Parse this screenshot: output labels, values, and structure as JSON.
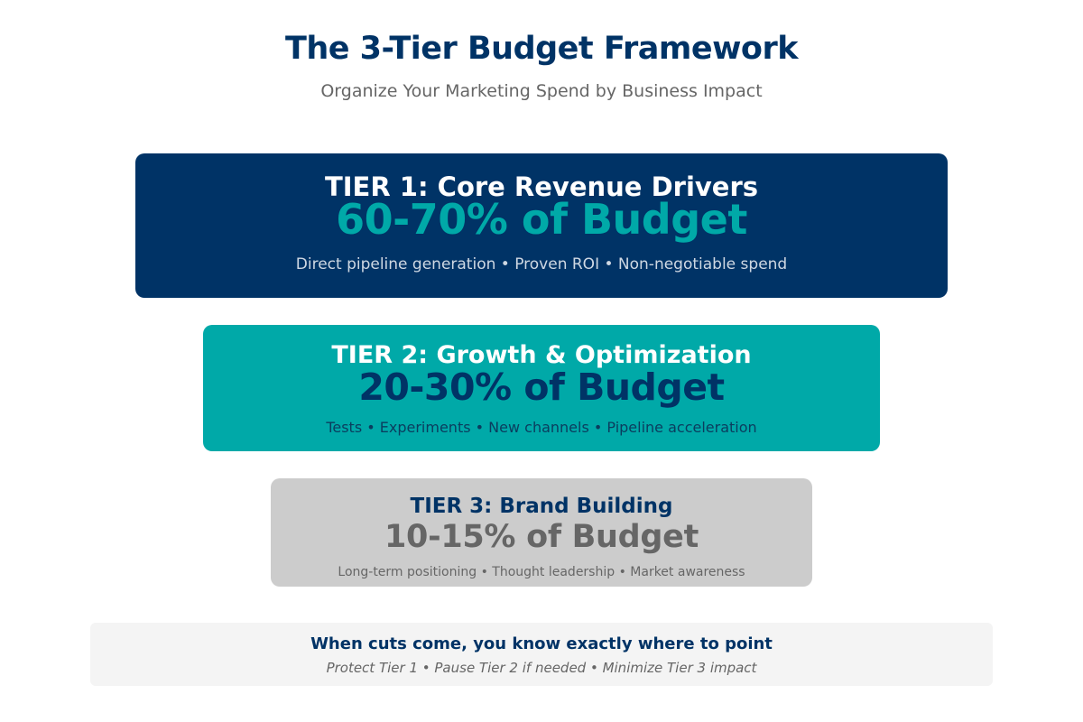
{
  "header": {
    "title": "The 3-Tier Budget Framework",
    "subtitle": "Organize Your Marketing Spend by Business Impact"
  },
  "tiers": [
    {
      "title": "TIER 1: Core Revenue Drivers",
      "percentage": "60-70% of Budget",
      "description": "Direct pipeline generation • Proven ROI • Non-negotiable spend",
      "color": "#003366"
    },
    {
      "title": "TIER 2: Growth & Optimization",
      "percentage": "20-30% of Budget",
      "description": "Tests • Experiments • New channels • Pipeline acceleration",
      "color": "#00a9a8"
    },
    {
      "title": "TIER 3: Brand Building",
      "percentage": "10-15% of Budget",
      "description": "Long-term positioning • Thought leadership • Market awareness",
      "color": "#cccccc"
    }
  ],
  "callout": {
    "title": "When cuts come, you know exactly where to point",
    "subtitle": "Protect Tier 1 • Pause Tier 2 if needed • Minimize Tier 3 impact"
  }
}
